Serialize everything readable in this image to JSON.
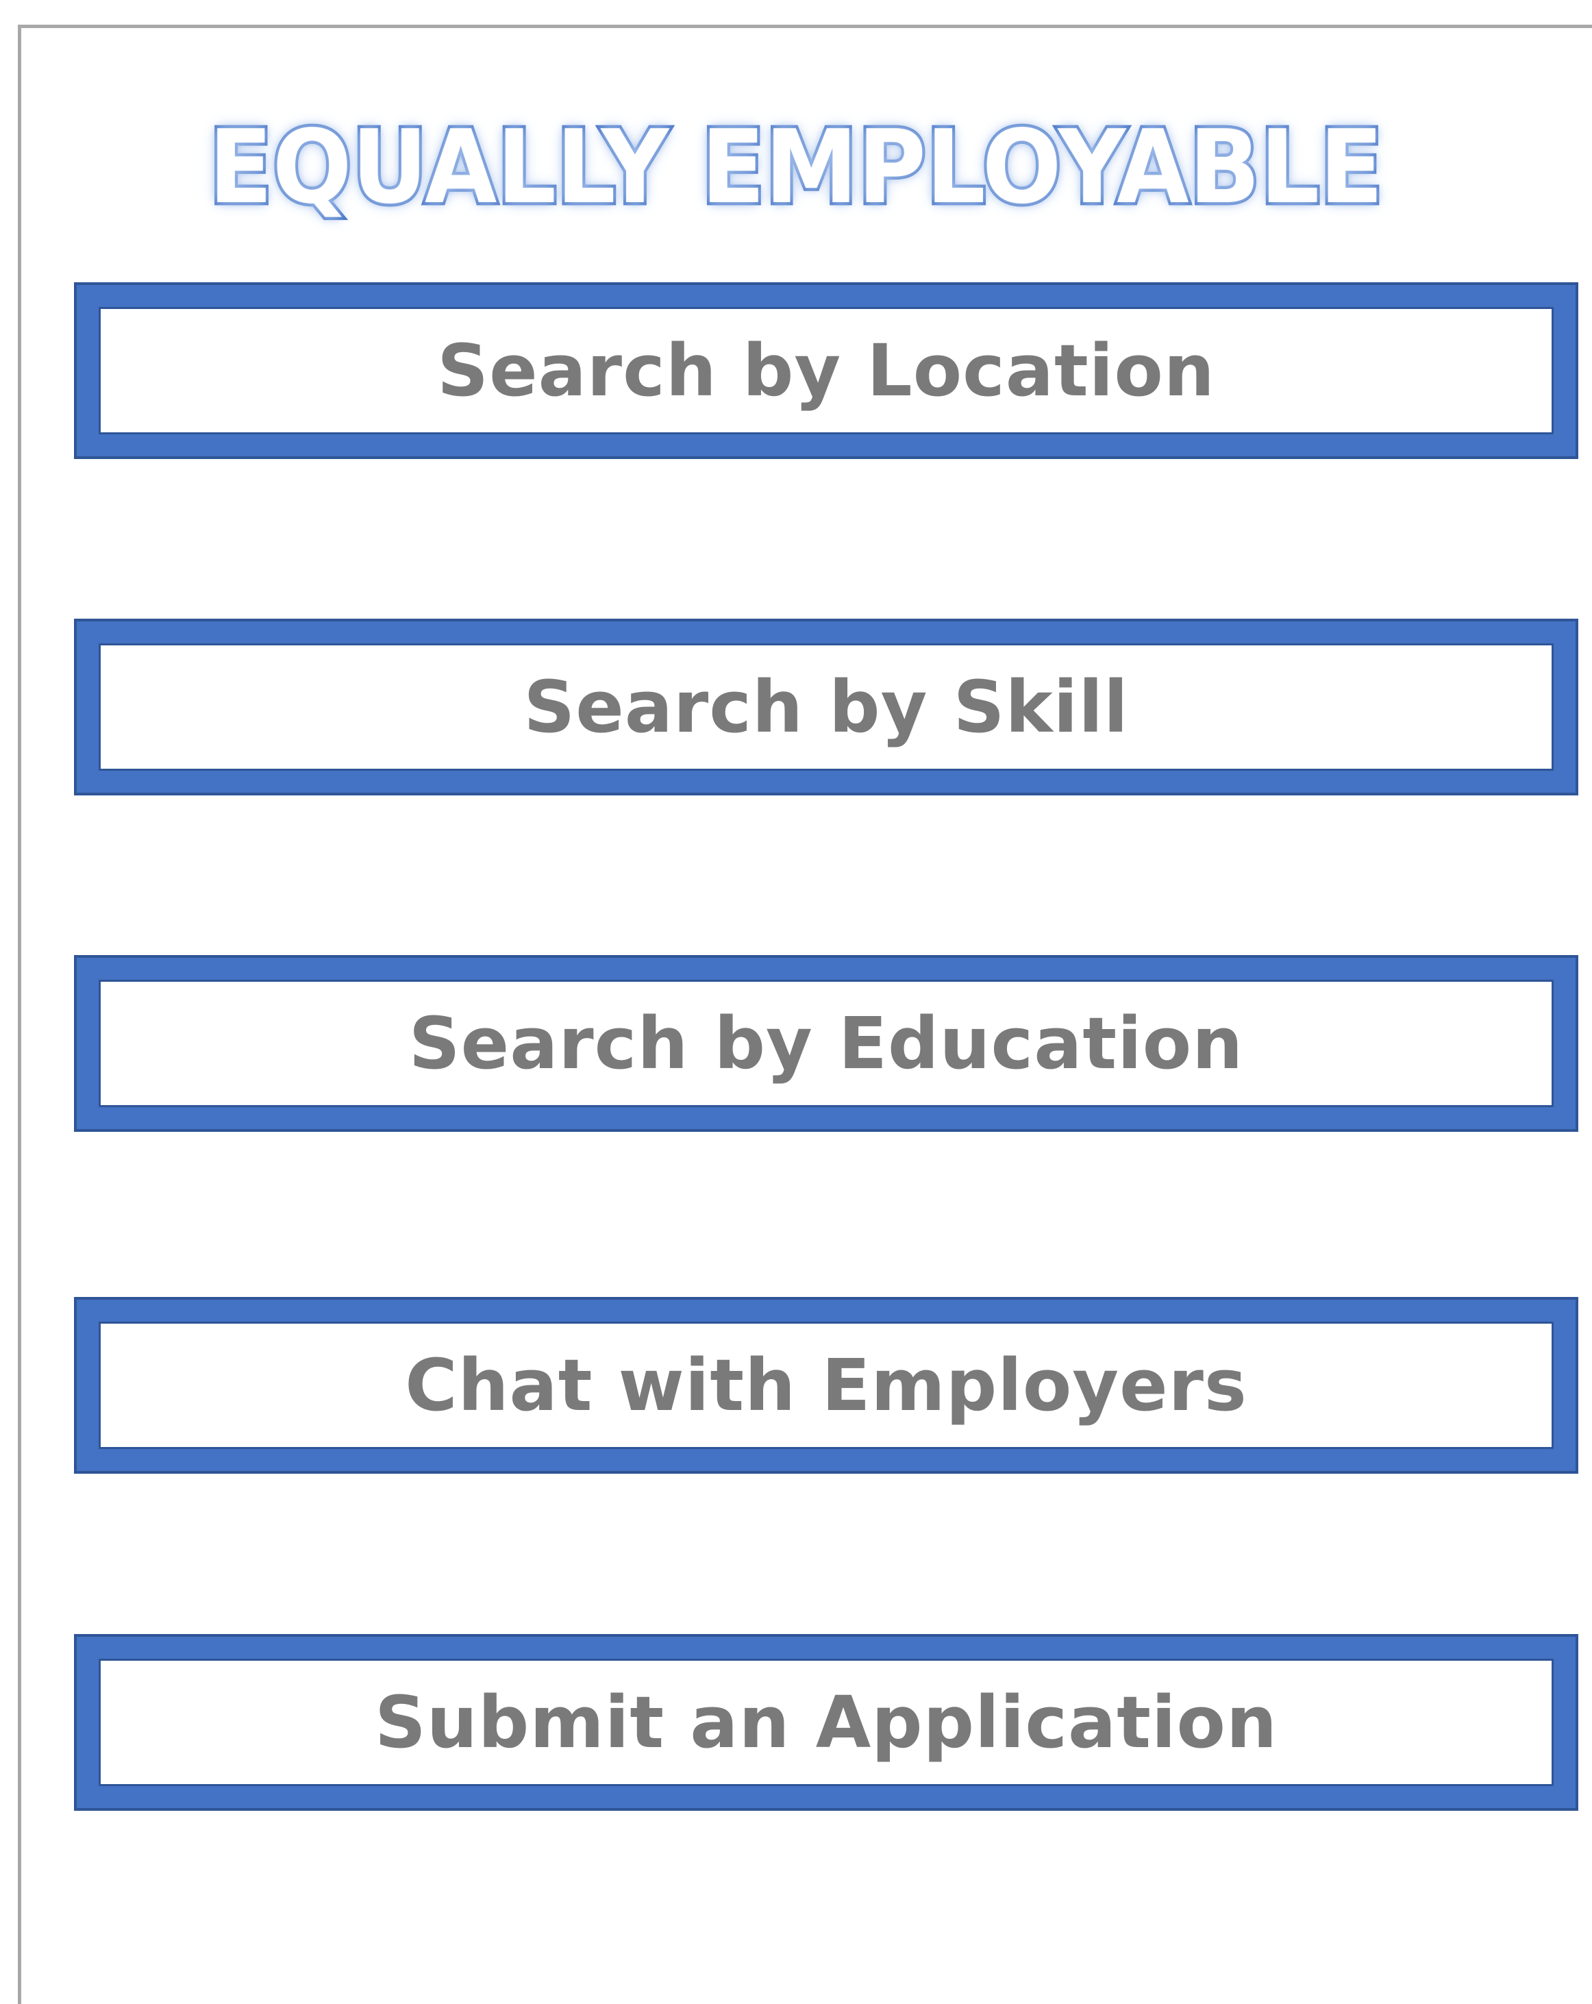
{
  "app": {
    "title": "EQUALLY EMPLOYABLE"
  },
  "menu": {
    "items": [
      {
        "label": "Search by Location"
      },
      {
        "label": "Search by Skill"
      },
      {
        "label": "Search by Education"
      },
      {
        "label": "Chat with Employers"
      },
      {
        "label": "Submit an Application"
      }
    ]
  },
  "colors": {
    "accent": "#4472c4",
    "accent_dark": "#2f5597",
    "label_text": "#7a7a7a",
    "frame": "#a8a8a8",
    "background": "#ffffff"
  }
}
